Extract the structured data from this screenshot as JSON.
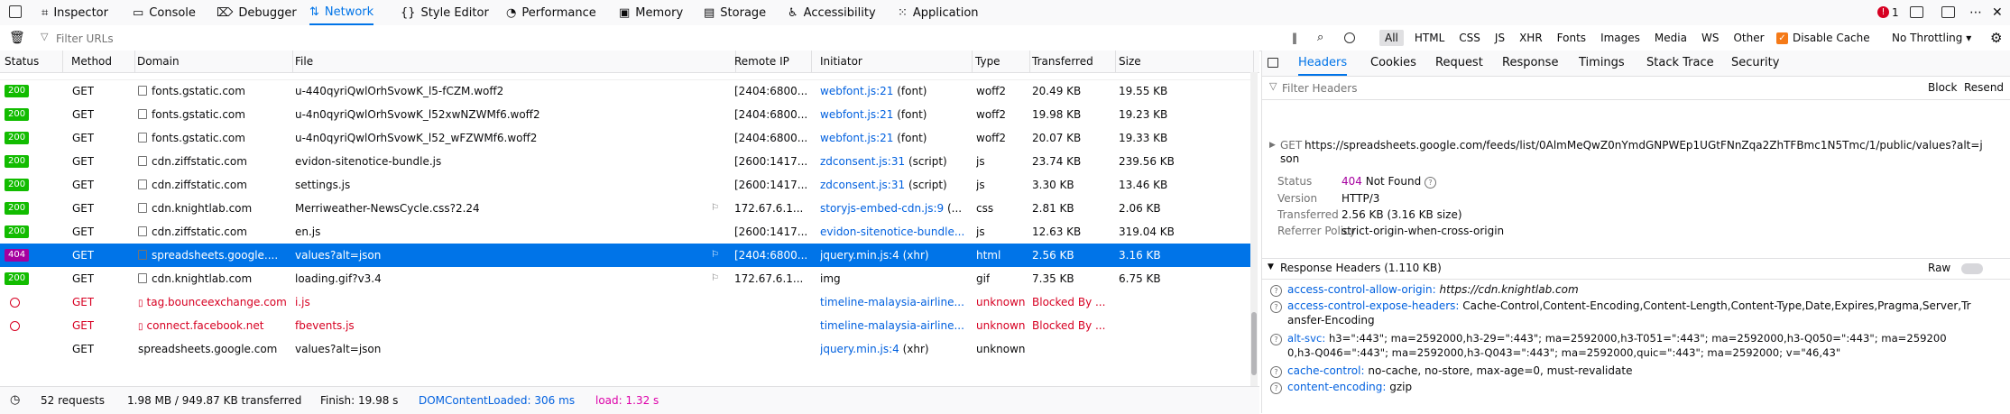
{
  "toolbar": {
    "tabs": [
      {
        "label": "Inspector",
        "icon": "inspector-icon"
      },
      {
        "label": "Console",
        "icon": "console-icon"
      },
      {
        "label": "Debugger",
        "icon": "debugger-icon"
      },
      {
        "label": "Network",
        "icon": "network-icon",
        "active": true
      },
      {
        "label": "Style Editor",
        "icon": "style-editor-icon"
      },
      {
        "label": "Performance",
        "icon": "performance-icon"
      },
      {
        "label": "Memory",
        "icon": "memory-icon"
      },
      {
        "label": "Storage",
        "icon": "storage-icon"
      },
      {
        "label": "Accessibility",
        "icon": "accessibility-icon"
      },
      {
        "label": "Application",
        "icon": "application-icon"
      }
    ],
    "error_count": "1"
  },
  "filterbar": {
    "placeholder": "Filter URLs",
    "types": [
      "All",
      "HTML",
      "CSS",
      "JS",
      "XHR",
      "Fonts",
      "Images",
      "Media",
      "WS",
      "Other"
    ],
    "disable_cache": "Disable Cache",
    "throttle": "No Throttling"
  },
  "columns": [
    "Status",
    "Method",
    "Domain",
    "File",
    "Remote IP",
    "Initiator",
    "Type",
    "Transferred",
    "Size"
  ],
  "rows": [
    {
      "status": "200",
      "method": "GET",
      "domain": "fonts.gstatic.com",
      "file": "u-440qyriQwlOrhSvowK_l5-fCZM.woff2",
      "ip": "[2404:6800...",
      "init": "webfont.js:21",
      "init_note": " (font)",
      "type": "woff2",
      "transferred": "20.49 KB",
      "size": "19.55 KB"
    },
    {
      "status": "200",
      "method": "GET",
      "domain": "fonts.gstatic.com",
      "file": "u-4n0qyriQwlOrhSvowK_l52xwNZWMf6.woff2",
      "ip": "[2404:6800...",
      "init": "webfont.js:21",
      "init_note": " (font)",
      "type": "woff2",
      "transferred": "19.98 KB",
      "size": "19.23 KB"
    },
    {
      "status": "200",
      "method": "GET",
      "domain": "fonts.gstatic.com",
      "file": "u-4n0qyriQwlOrhSvowK_l52_wFZWMf6.woff2",
      "ip": "[2404:6800...",
      "init": "webfont.js:21",
      "init_note": " (font)",
      "type": "woff2",
      "transferred": "20.07 KB",
      "size": "19.33 KB"
    },
    {
      "status": "200",
      "method": "GET",
      "domain": "cdn.ziffstatic.com",
      "file": "evidon-sitenotice-bundle.js",
      "ip": "[2600:1417...",
      "init": "zdconsent.js:31",
      "init_note": " (script)",
      "type": "js",
      "transferred": "23.74 KB",
      "size": "239.56 KB"
    },
    {
      "status": "200",
      "method": "GET",
      "domain": "cdn.ziffstatic.com",
      "file": "settings.js",
      "ip": "[2600:1417...",
      "init": "zdconsent.js:31",
      "init_note": " (script)",
      "type": "js",
      "transferred": "3.30 KB",
      "size": "13.46 KB"
    },
    {
      "status": "200",
      "method": "GET",
      "domain": "cdn.knightlab.com",
      "file": "Merriweather-NewsCycle.css?2.24",
      "ip": "172.67.6.1...",
      "init": "storyjs-embed-cdn.js:9",
      "init_note": " (...",
      "type": "css",
      "transferred": "2.81 KB",
      "size": "2.06 KB"
    },
    {
      "status": "200",
      "method": "GET",
      "domain": "cdn.ziffstatic.com",
      "file": "en.js",
      "ip": "[2600:1417...",
      "init": "evidon-sitenotice-bundle...",
      "init_note": "",
      "type": "js",
      "transferred": "12.63 KB",
      "size": "319.04 KB"
    },
    {
      "status": "404",
      "method": "GET",
      "domain": "spreadsheets.google....",
      "file": "values?alt=json",
      "ip": "[2404:6800...",
      "init": "jquery.min.js:4",
      "init_note": " (xhr)",
      "type": "html",
      "transferred": "2.56 KB",
      "size": "3.16 KB",
      "selected": true
    },
    {
      "status": "200",
      "method": "GET",
      "domain": "cdn.knightlab.com",
      "file": "loading.gif?v3.4",
      "ip": "172.67.6.1...",
      "init": "img",
      "init_note": "",
      "type": "gif",
      "transferred": "7.35 KB",
      "size": "6.75 KB"
    },
    {
      "status": "blocked",
      "method": "GET",
      "domain": "tag.bounceexchange.com",
      "file": "i.js",
      "ip": "",
      "init": "timeline-malaysia-airline...",
      "init_note": "",
      "type": "unknown",
      "transferred": "Blocked By ...",
      "size": ""
    },
    {
      "status": "blocked",
      "method": "GET",
      "domain": "connect.facebook.net",
      "file": "fbevents.js",
      "ip": "",
      "init": "timeline-malaysia-airline...",
      "init_note": "",
      "type": "unknown",
      "transferred": "Blocked By ...",
      "size": ""
    },
    {
      "status": "",
      "method": "GET",
      "domain": "spreadsheets.google.com",
      "file": "values?alt=json",
      "ip": "",
      "init": "jquery.min.js:4",
      "init_note": " (xhr)",
      "type": "unknown",
      "transferred": "",
      "size": ""
    }
  ],
  "statusbar": {
    "requests": "52 requests",
    "transferred": "1.98 MB / 949.87 KB transferred",
    "finish": "Finish: 19.98 s",
    "dcl": "DOMContentLoaded: 306 ms",
    "load": "load: 1.32 s"
  },
  "side": {
    "tabs": [
      "Headers",
      "Cookies",
      "Request",
      "Response",
      "Timings",
      "Stack Trace",
      "Security"
    ],
    "filter_placeholder": "Filter Headers",
    "block": "Block",
    "resend": "Resend",
    "method": "GET",
    "url": "https://spreadsheets.google.com/feeds/list/0AlmMeQwZ0nYmdGNPWEp1UGtFNnZqa2ZhTFBmc1N5Tmc/1/public/values?alt=j",
    "url_rest": "son",
    "summary": [
      {
        "k": "Status",
        "v": "404 Not Found"
      },
      {
        "k": "Version",
        "v": "HTTP/3"
      },
      {
        "k": "Transferred",
        "v": "2.56 KB (3.16 KB size)"
      },
      {
        "k": "Referrer Policy",
        "v": "strict-origin-when-cross-origin"
      }
    ],
    "resp_headers_title": "Response Headers (1.110 KB)",
    "raw": "Raw",
    "headers": [
      {
        "name": "access-control-allow-origin:",
        "value": "https://cdn.knightlab.com",
        "cont": ""
      },
      {
        "name": "access-control-expose-headers:",
        "value": "Cache-Control,Content-Encoding,Content-Length,Content-Type,Date,Expires,Pragma,Server,Tr",
        "cont": "ansfer-Encoding"
      },
      {
        "name": "alt-svc:",
        "value": "h3=\":443\"; ma=2592000,h3-29=\":443\"; ma=2592000,h3-T051=\":443\"; ma=2592000,h3-Q050=\":443\"; ma=259200",
        "cont": "0,h3-Q046=\":443\"; ma=2592000,h3-Q043=\":443\"; ma=2592000,quic=\":443\"; ma=2592000; v=\"46,43\""
      },
      {
        "name": "cache-control:",
        "value": "no-cache, no-store, max-age=0, must-revalidate",
        "cont": ""
      },
      {
        "name": "content-encoding:",
        "value": "gzip",
        "cont": ""
      }
    ]
  }
}
